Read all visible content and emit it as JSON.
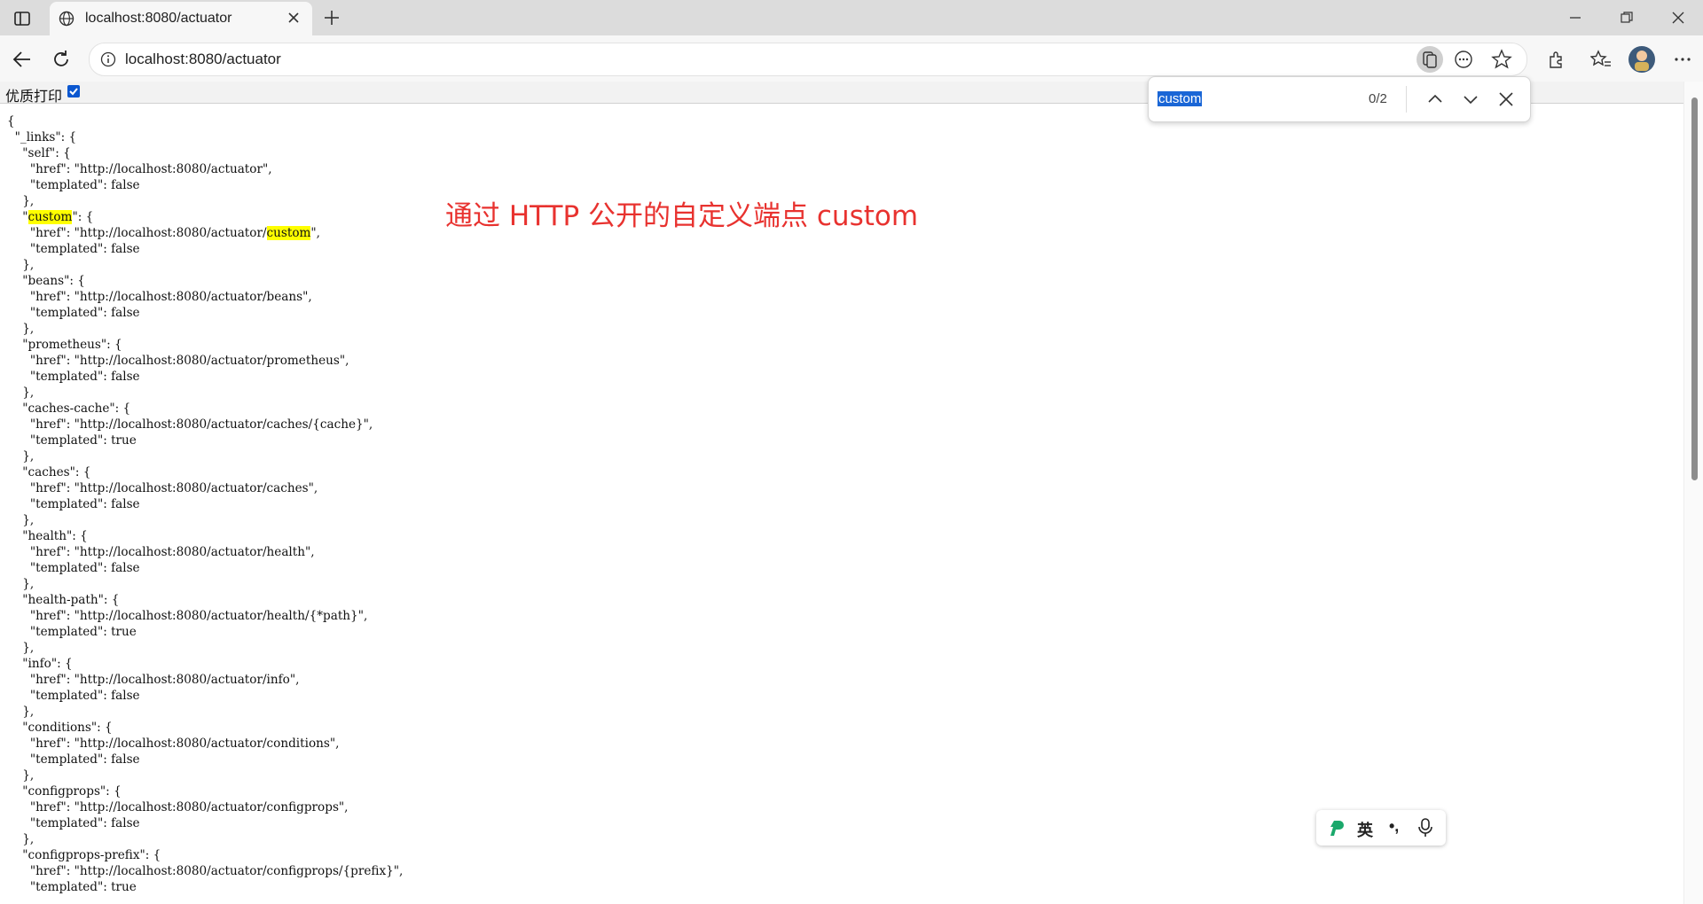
{
  "browser": {
    "tab_title": "localhost:8080/actuator",
    "address": "localhost:8080/actuator",
    "find_query": "custom",
    "find_count": "0/2"
  },
  "page": {
    "print_label": "优质打印",
    "annotation": "通过 HTTP 公开的自定义端点 custom",
    "json_lines": [
      "{",
      "  \"_links\": {",
      "    \"self\": {",
      "      \"href\": \"http://localhost:8080/actuator\",",
      "      \"templated\": false",
      "    },",
      "    \"custom\": {",
      "      \"href\": \"http://localhost:8080/actuator/custom\",",
      "      \"templated\": false",
      "    },",
      "    \"beans\": {",
      "      \"href\": \"http://localhost:8080/actuator/beans\",",
      "      \"templated\": false",
      "    },",
      "    \"prometheus\": {",
      "      \"href\": \"http://localhost:8080/actuator/prometheus\",",
      "      \"templated\": false",
      "    },",
      "    \"caches-cache\": {",
      "      \"href\": \"http://localhost:8080/actuator/caches/{cache}\",",
      "      \"templated\": true",
      "    },",
      "    \"caches\": {",
      "      \"href\": \"http://localhost:8080/actuator/caches\",",
      "      \"templated\": false",
      "    },",
      "    \"health\": {",
      "      \"href\": \"http://localhost:8080/actuator/health\",",
      "      \"templated\": false",
      "    },",
      "    \"health-path\": {",
      "      \"href\": \"http://localhost:8080/actuator/health/{*path}\",",
      "      \"templated\": true",
      "    },",
      "    \"info\": {",
      "      \"href\": \"http://localhost:8080/actuator/info\",",
      "      \"templated\": false",
      "    },",
      "    \"conditions\": {",
      "      \"href\": \"http://localhost:8080/actuator/conditions\",",
      "      \"templated\": false",
      "    },",
      "    \"configprops\": {",
      "      \"href\": \"http://localhost:8080/actuator/configprops\",",
      "      \"templated\": false",
      "    },",
      "    \"configprops-prefix\": {",
      "      \"href\": \"http://localhost:8080/actuator/configprops/{prefix}\",",
      "      \"templated\": true"
    ]
  },
  "ime": {
    "lang": "英",
    "punct": "•,"
  },
  "icons": [
    "sidebar-icon",
    "globe-icon",
    "close-icon",
    "plus-icon",
    "minimize-icon",
    "restore-icon",
    "window-close-icon",
    "back-icon",
    "refresh-icon",
    "info-icon",
    "read-aloud-icon",
    "more-circle-icon",
    "star-icon",
    "extensions-icon",
    "favorites-icon",
    "avatar",
    "menu-icon",
    "chevron-up-icon",
    "chevron-down-icon",
    "ime-logo-icon",
    "mic-icon"
  ],
  "colors": {
    "highlight": "#ffff00",
    "annotation": "#e8322f",
    "selection": "#1a66d6"
  }
}
